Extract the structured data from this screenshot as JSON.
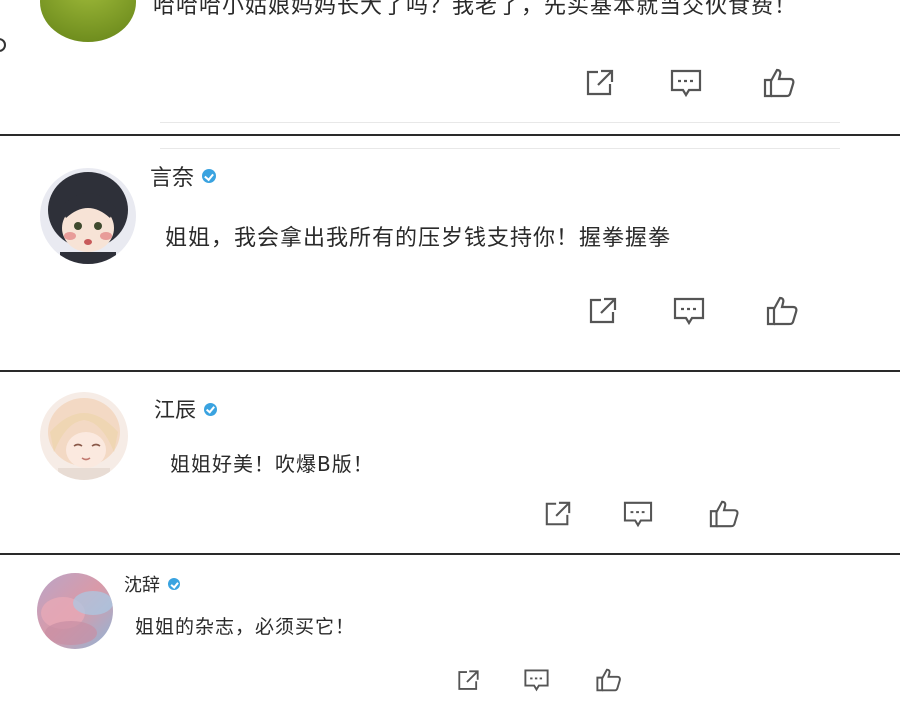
{
  "comments": [
    {
      "comment": "哈哈哈小姑娘妈妈长大了吗？我老了，先买基本就当交伙食费！",
      "avatar_icon": "green-landscape-avatar",
      "actions": {
        "share_icon": "share-icon",
        "reply_icon": "comment-icon",
        "like_icon": "thumbs-up-icon"
      }
    },
    {
      "username": "言奈",
      "comment": "姐姐，我会拿出我所有的压岁钱支持你！握拳握拳",
      "avatar_icon": "anime-boy-avatar",
      "actions": {
        "share_icon": "share-icon",
        "reply_icon": "comment-icon",
        "like_icon": "thumbs-up-icon"
      }
    },
    {
      "username": "江辰",
      "comment": "姐姐好美！吹爆B版！",
      "avatar_icon": "anime-blonde-avatar",
      "actions": {
        "share_icon": "share-icon",
        "reply_icon": "comment-icon",
        "like_icon": "thumbs-up-icon"
      }
    },
    {
      "username": "沈辞",
      "comment": "姐姐的杂志，必须买它！",
      "avatar_icon": "pink-sky-avatar",
      "actions": {
        "share_icon": "share-icon",
        "reply_icon": "comment-icon",
        "like_icon": "thumbs-up-icon"
      }
    }
  ],
  "colors": {
    "verified": "#3aa3e0",
    "separator": "#2a2a2a",
    "icon": "#555555"
  }
}
